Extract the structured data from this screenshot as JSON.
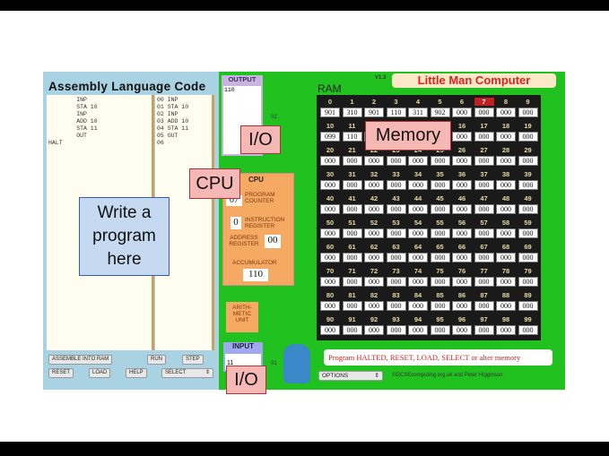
{
  "left": {
    "title": "Assembly Language Code",
    "source": "        INP\n        STA 10\n        INP\n        ADD 10\n        STA 11\n        OUT\nHALT",
    "listing": "00 INP\n01 STA 10\n02 INP\n03 ADD 10\n04 STA 11\n05 OUT\n06",
    "buttons": {
      "assemble": "ASSEMBLE INTO RAM",
      "run": "RUN",
      "step": "STEP",
      "reset": "RESET",
      "load": "LOAD",
      "help": "HELP",
      "select": "SELECT"
    }
  },
  "output": {
    "label": "OUTPUT",
    "value": "110",
    "port": "02"
  },
  "input": {
    "label": "INPUT",
    "value": "11",
    "port": "01"
  },
  "version": "V1.3",
  "app_title": "Little Man Computer",
  "ram_label": "RAM",
  "cpu": {
    "label": "CPU",
    "pc_label": "PROGRAM COUNTER",
    "pc": "07",
    "ir_label": "INSTRUCTION REGISTER",
    "ir": "0",
    "ar_label": "ADDRESS REGISTER",
    "ar": "00",
    "acc_label": "ACCUMULATOR",
    "acc": "110",
    "alu_label": "ARITH-METIC UNIT"
  },
  "memory": {
    "active_cell": 7,
    "values": [
      "901",
      "310",
      "901",
      "110",
      "311",
      "902",
      "000",
      "000",
      "000",
      "000",
      "099",
      "110",
      "000",
      "000",
      "000",
      "000",
      "000",
      "000",
      "000",
      "000",
      "000",
      "000",
      "000",
      "000",
      "000",
      "000",
      "000",
      "000",
      "000",
      "000",
      "000",
      "000",
      "000",
      "000",
      "000",
      "000",
      "000",
      "000",
      "000",
      "000",
      "000",
      "000",
      "000",
      "000",
      "000",
      "000",
      "000",
      "000",
      "000",
      "000",
      "000",
      "000",
      "000",
      "000",
      "000",
      "000",
      "000",
      "000",
      "000",
      "000",
      "000",
      "000",
      "000",
      "000",
      "000",
      "000",
      "000",
      "000",
      "000",
      "000",
      "000",
      "000",
      "000",
      "000",
      "000",
      "000",
      "000",
      "000",
      "000",
      "000",
      "000",
      "000",
      "000",
      "000",
      "000",
      "000",
      "000",
      "000",
      "000",
      "000",
      "000",
      "000",
      "000",
      "000",
      "000",
      "000",
      "000",
      "000",
      "000",
      "000"
    ]
  },
  "status": "Program HALTED, RESET, LOAD, SELECT or alter memory",
  "options": "OPTIONS",
  "credit": "©GCSEcomputing.org.uk and Peter Higginson",
  "notes": {
    "program": "Write a program here",
    "cpu": "CPU",
    "io_top": "I/O",
    "memory": "Memory",
    "io_bottom": "I/O"
  }
}
